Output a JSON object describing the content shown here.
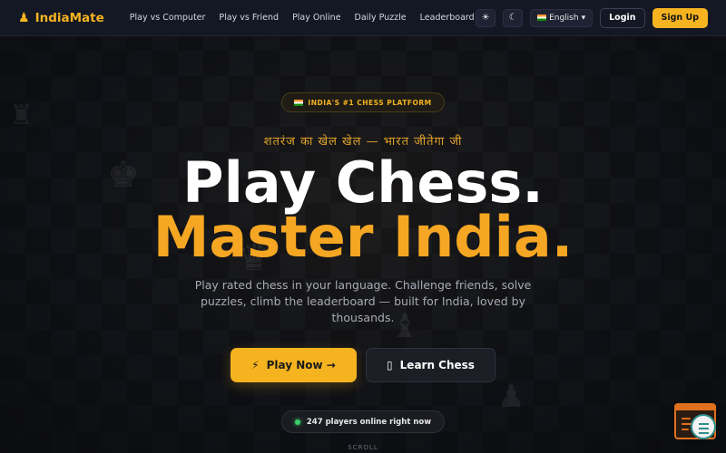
{
  "nav": {
    "logo_text": "IndiaMate",
    "logo_icon": "pawn-icon",
    "links": [
      "Play vs Computer",
      "Play vs Friend",
      "Play Online",
      "Daily Puzzle",
      "Leaderboard"
    ],
    "theme_icon": "sun-icon",
    "second_icon": "moon-icon",
    "language": "English",
    "language_icon": "flag-icon",
    "login": "Login",
    "signup": "Sign Up"
  },
  "hero": {
    "badge": "INDIA'S #1 CHESS PLATFORM",
    "badge_icon": "flag-icon",
    "hindi_line": "शतरंज का खेल खेल — भारत जीतेगा जी",
    "title_line1": "Play Chess.",
    "title_line2": "Master India.",
    "subtitle": "Play rated chess in your language. Challenge friends, solve puzzles, climb the leaderboard — built for India, loved by thousands.",
    "play_button": "Play Now →",
    "play_icon": "lightning-icon",
    "learn_button": "Learn Chess",
    "learn_icon": "book-icon",
    "online_text": "247 players online right now",
    "scroll_hint": "SCROLL"
  },
  "colors": {
    "accent": "#f5b320",
    "title_accent": "#f5a623",
    "background": "#0f1117",
    "online_dot": "#3ad06b"
  }
}
